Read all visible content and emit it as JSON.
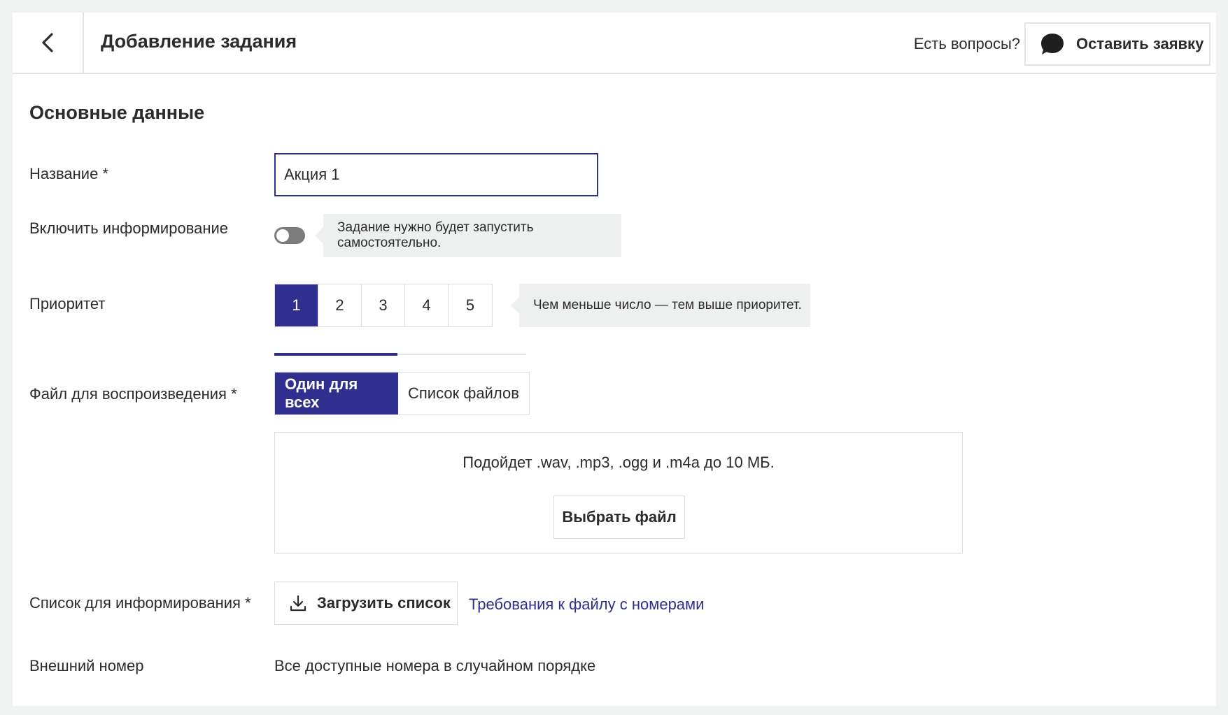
{
  "header": {
    "title": "Добавление задания",
    "questions": "Есть вопросы?",
    "request_button": "Оставить заявку"
  },
  "section": {
    "title": "Основные данные"
  },
  "fields": {
    "name": {
      "label": "Название *",
      "value": "Акция 1"
    },
    "informing": {
      "label": "Включить информирование",
      "enabled": false,
      "hint": "Задание нужно будет запустить самостоятельно."
    },
    "priority": {
      "label": "Приоритет",
      "options": [
        "1",
        "2",
        "3",
        "4",
        "5"
      ],
      "selected": "1",
      "hint": "Чем меньше число — тем выше приоритет."
    },
    "playback_file": {
      "label": "Файл для воспроизведения *",
      "options": [
        "Один для всех",
        "Список файлов"
      ],
      "selected": "Один для всех",
      "upload_hint": "Подойдет .wav, .mp3, .ogg и .m4a до 10 МБ.",
      "choose_button": "Выбрать файл"
    },
    "informing_list": {
      "label": "Список для информирования *",
      "upload_button": "Загрузить список",
      "requirements_link": "Требования к файлу с номерами"
    },
    "external_number": {
      "label": "Внешний номер",
      "value": "Все доступные номера в случайном порядке"
    }
  },
  "colors": {
    "accent": "#2e2f8f",
    "hint_bg": "#eef0f0",
    "toggle_off": "#7b7c7e"
  }
}
